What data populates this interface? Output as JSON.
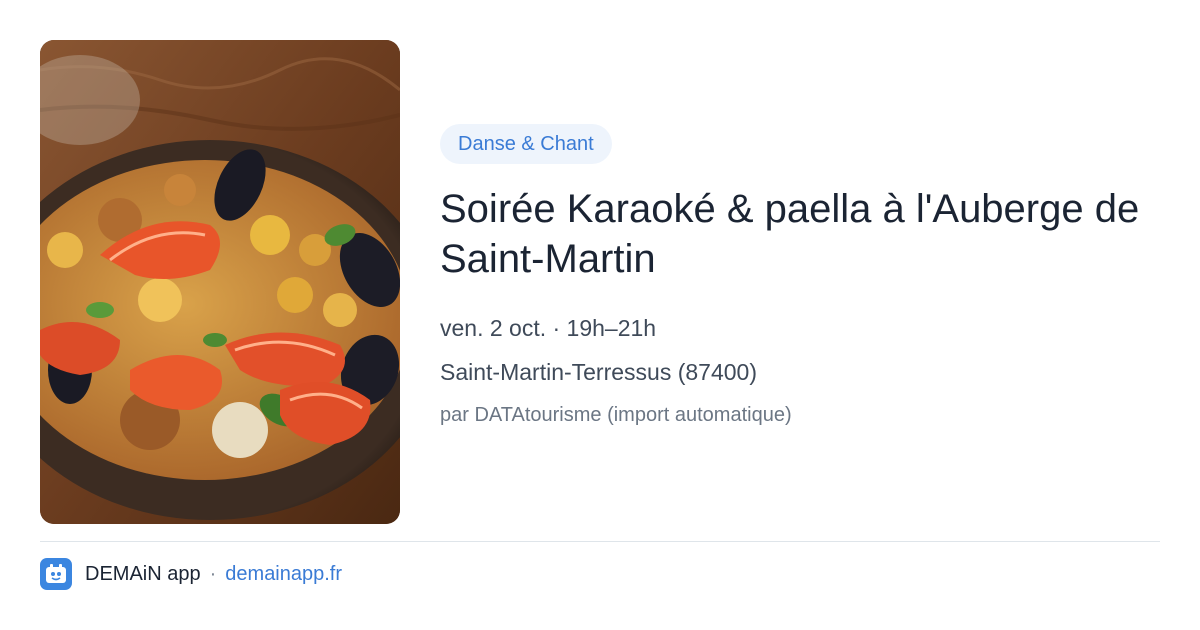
{
  "event": {
    "category": "Danse & Chant",
    "title": "Soirée Karaoké & paella à l'Auberge de Saint-Martin",
    "date_time": "ven. 2 oct. · 19h–21h",
    "location": "Saint-Martin-Terressus (87400)",
    "source": "par DATAtourisme (import automatique)",
    "image_subject": "paella-photo"
  },
  "footer": {
    "app_name": "DEMAiN app",
    "separator": "·",
    "link_text": "demainapp.fr",
    "logo_icon": "demain-app-logo-icon"
  },
  "colors": {
    "accent": "#3a7bd5",
    "badge_background": "#eef4fc",
    "title": "#1b2433",
    "meta_text": "#3f4a59",
    "muted_text": "#6b7684",
    "logo_background": "#3b86e0"
  }
}
